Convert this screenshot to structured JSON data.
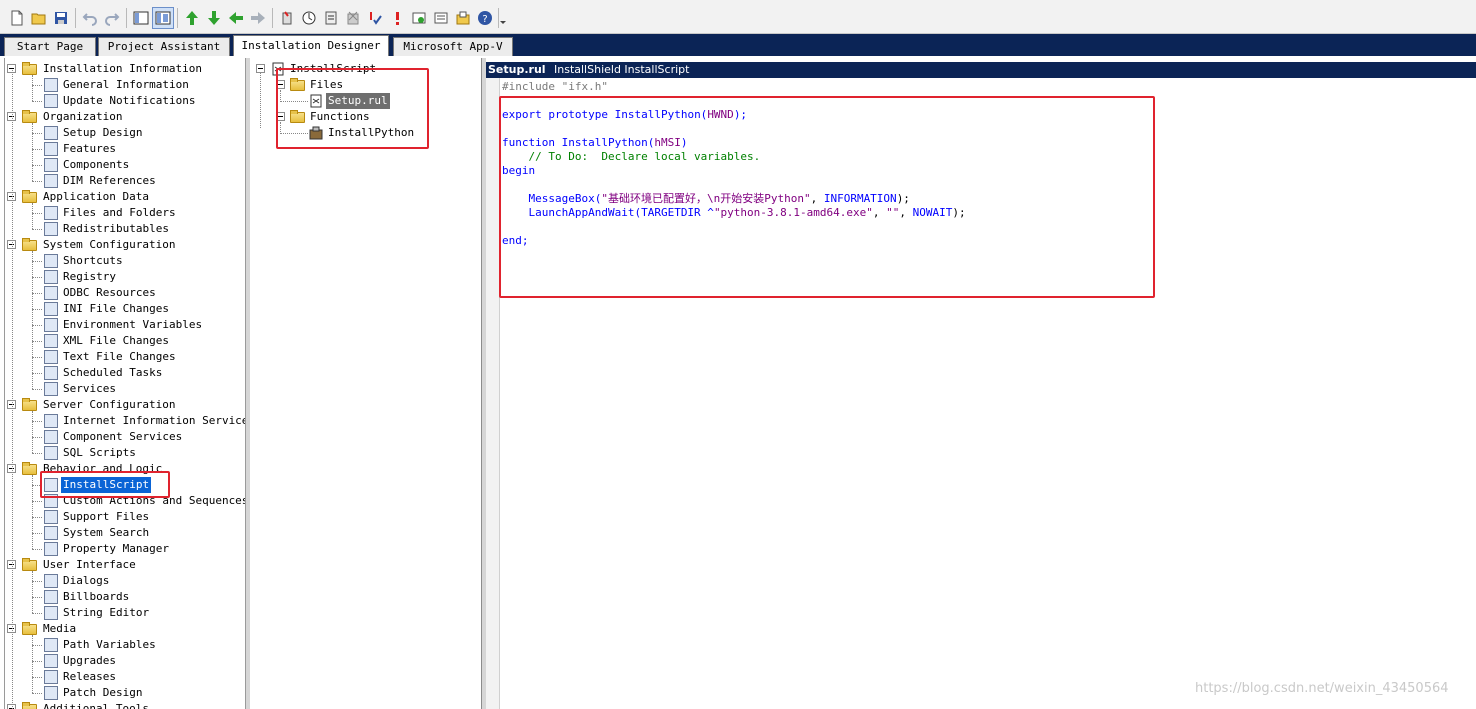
{
  "toolbar": {
    "icons": [
      "new-file-icon",
      "open-folder-icon",
      "save-icon",
      "undo-icon",
      "redo-icon",
      "view-icon",
      "view-active-icon",
      "arrow-up-icon",
      "arrow-down-icon",
      "arrow-left-icon",
      "arrow-right-icon",
      "build-icon",
      "compile-icon",
      "release-icon",
      "remove-icon",
      "validate-icon",
      "error-icon",
      "settings-icon",
      "properties-icon",
      "options-icon",
      "help-icon"
    ]
  },
  "tabs": [
    {
      "label": "Start Page"
    },
    {
      "label": "Project Assistant"
    },
    {
      "label": "Installation Designer"
    },
    {
      "label": "Microsoft App-V"
    }
  ],
  "left_tree": {
    "groups": [
      {
        "label": "Installation Information",
        "items": [
          "General Information",
          "Update Notifications"
        ]
      },
      {
        "label": "Organization",
        "items": [
          "Setup Design",
          "Features",
          "Components",
          "DIM References"
        ]
      },
      {
        "label": "Application Data",
        "items": [
          "Files and Folders",
          "Redistributables"
        ]
      },
      {
        "label": "System Configuration",
        "items": [
          "Shortcuts",
          "Registry",
          "ODBC Resources",
          "INI File Changes",
          "Environment Variables",
          "XML File Changes",
          "Text File Changes",
          "Scheduled Tasks",
          "Services"
        ]
      },
      {
        "label": "Server Configuration",
        "items": [
          "Internet Information Services",
          "Component Services",
          "SQL Scripts"
        ]
      },
      {
        "label": "Behavior and Logic",
        "items": [
          "InstallScript",
          "Custom Actions and Sequences",
          "Support Files",
          "System Search",
          "Property Manager"
        ]
      },
      {
        "label": "User Interface",
        "items": [
          "Dialogs",
          "Billboards",
          "String Editor"
        ]
      },
      {
        "label": "Media",
        "items": [
          "Path Variables",
          "Upgrades",
          "Releases",
          "Patch Design"
        ]
      },
      {
        "label": "Additional Tools",
        "items": []
      }
    ],
    "selected": "InstallScript"
  },
  "mid_tree": {
    "root": "InstallScript",
    "files_label": "Files",
    "file": "Setup.rul",
    "functions_label": "Functions",
    "function": "InstallPython"
  },
  "editor": {
    "filename": "Setup.rul",
    "description": "InstallShield InstallScript",
    "line1": "#include \"ifx.h\"",
    "line3_kw": "export prototype ",
    "line3_fn": "InstallPython(",
    "line3_arg": "HWND",
    "line3_end": ");",
    "line5_kw": "function ",
    "line5_fn": "InstallPython(",
    "line5_arg": "hMSI",
    "line5_end": ")",
    "line6": "    // To Do:  Declare local variables.",
    "line7": "begin",
    "line9_fn": "    MessageBox(",
    "line9_str": "\"基础环境已配置好，\\n开始安装Python\"",
    "line9_mid": ", ",
    "line9_const": "INFORMATION",
    "line9_end": ");",
    "line10_fn": "    LaunchAppAndWait(",
    "line10_var": "TARGETDIR ^",
    "line10_str": "\"python-3.8.1-amd64.exe\"",
    "line10_mid": ", ",
    "line10_str2": "\"\"",
    "line10_mid2": ", ",
    "line10_const": "NOWAIT",
    "line10_end": ");",
    "line12": "end;"
  },
  "watermark": "https://blog.csdn.net/weixin_43450564",
  "colors": {
    "accent": "#0b2456",
    "annotation": "#e0232e",
    "selection": "#0a64d6"
  }
}
